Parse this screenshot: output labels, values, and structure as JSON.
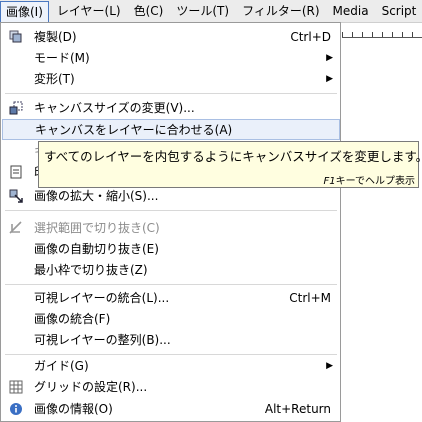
{
  "menubar": [
    {
      "label": "画像(I)",
      "active": true
    },
    {
      "label": "レイヤー(L)"
    },
    {
      "label": "色(C)"
    },
    {
      "label": "ツール(T)"
    },
    {
      "label": "フィルター(R)"
    },
    {
      "label": "Media"
    },
    {
      "label": "Script"
    }
  ],
  "menu": {
    "duplicate": {
      "label": "複製(D)",
      "accel": "Ctrl+D"
    },
    "mode": {
      "label": "モード(M)"
    },
    "transform": {
      "label": "変形(T)"
    },
    "canvas_size": {
      "label": "キャンバスサイズの変更(V)..."
    },
    "fit_canvas": {
      "label": "キャンバスをレイヤーに合わせる(A)"
    },
    "fit_canvas_sel": {
      "label": "キ"
    },
    "print_size": {
      "label": "印刷"
    },
    "scale_image": {
      "label": "画像の拡大・縮小(S)..."
    },
    "crop_selection": {
      "label": "選択範囲で切り抜き(C)"
    },
    "autocrop": {
      "label": "画像の自動切り抜き(E)"
    },
    "zealous_crop": {
      "label": "最小枠で切り抜き(Z)"
    },
    "merge_visible": {
      "label": "可視レイヤーの統合(L)...",
      "accel": "Ctrl+M"
    },
    "flatten": {
      "label": "画像の統合(F)"
    },
    "align_visible": {
      "label": "可視レイヤーの整列(B)..."
    },
    "guides": {
      "label": "ガイド(G)"
    },
    "grid": {
      "label": "グリッドの設定(R)..."
    },
    "properties": {
      "label": "画像の情報(O)",
      "accel": "Alt+Return"
    }
  },
  "tooltip": {
    "text": "すべてのレイヤーを内包するようにキャンバスサイズを変更します。",
    "key": "F1",
    "help": "キーでヘルプ表示"
  }
}
